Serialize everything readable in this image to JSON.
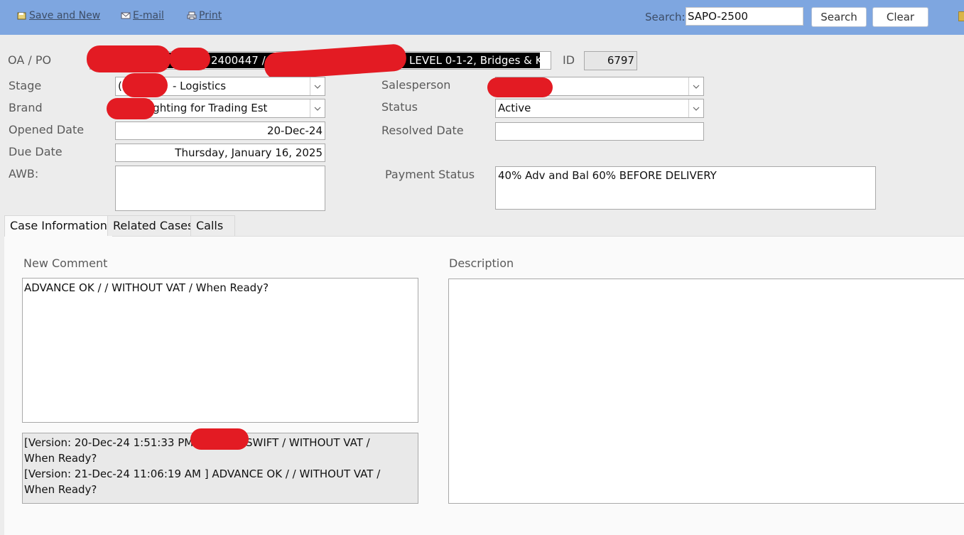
{
  "toolbar": {
    "save_new_label": "Save and New",
    "email_label": "E-mail",
    "print_label": "Print",
    "search_label": "Search:",
    "search_value": "SAPO-2500",
    "search_button": "Search",
    "clear_button": "Clear"
  },
  "form": {
    "oa_po_label": "OA / PO",
    "oa_po_visible_fragment_1": "2400447 / ",
    "oa_po_visible_fragment_2": "LEVEL 0-1-2, Bridges & K",
    "id_label": "ID",
    "id_value": "6797",
    "stage_label": "Stage",
    "stage_value_prefix": "(4",
    "stage_value_suffix": "- Logistics",
    "brand_label": "Brand",
    "brand_value": "ighting for Trading Est",
    "opened_date_label": "Opened Date",
    "opened_date_value": "20-Dec-24",
    "due_date_label": "Due Date",
    "due_date_value": "Thursday, January 16, 2025",
    "awb_label": "AWB:",
    "awb_value": "",
    "salesperson_label": "Salesperson",
    "salesperson_value": "",
    "status_label": "Status",
    "status_value": "Active",
    "resolved_date_label": "Resolved Date",
    "resolved_date_value": "",
    "payment_status_label": "Payment Status",
    "payment_status_value": "40% Adv and Bal 60% BEFORE DELIVERY"
  },
  "tabs": [
    {
      "label": "Case Information",
      "active": true
    },
    {
      "label": "Related Cases",
      "active": false
    },
    {
      "label": "Calls",
      "active": false
    }
  ],
  "case_info": {
    "new_comment_label": "New Comment",
    "new_comment_value": "ADVANCE OK /   /  WITHOUT VAT / When Ready?",
    "history_line_1a": "[Version:  20-Dec-24 1:51:33 PM",
    "history_line_1b": "SWIFT /  WITHOUT VAT /",
    "history_line_2": "When Ready?",
    "history_line_3": "[Version:  21-Dec-24 11:06:19 AM ] ADVANCE OK /   /  WITHOUT VAT /",
    "history_line_4": "When Ready?",
    "description_label": "Description",
    "description_value": ""
  },
  "colors": {
    "toolbar_bg": "#7ea6e0",
    "redaction": "#e31b23",
    "page_bg": "#ececec"
  }
}
